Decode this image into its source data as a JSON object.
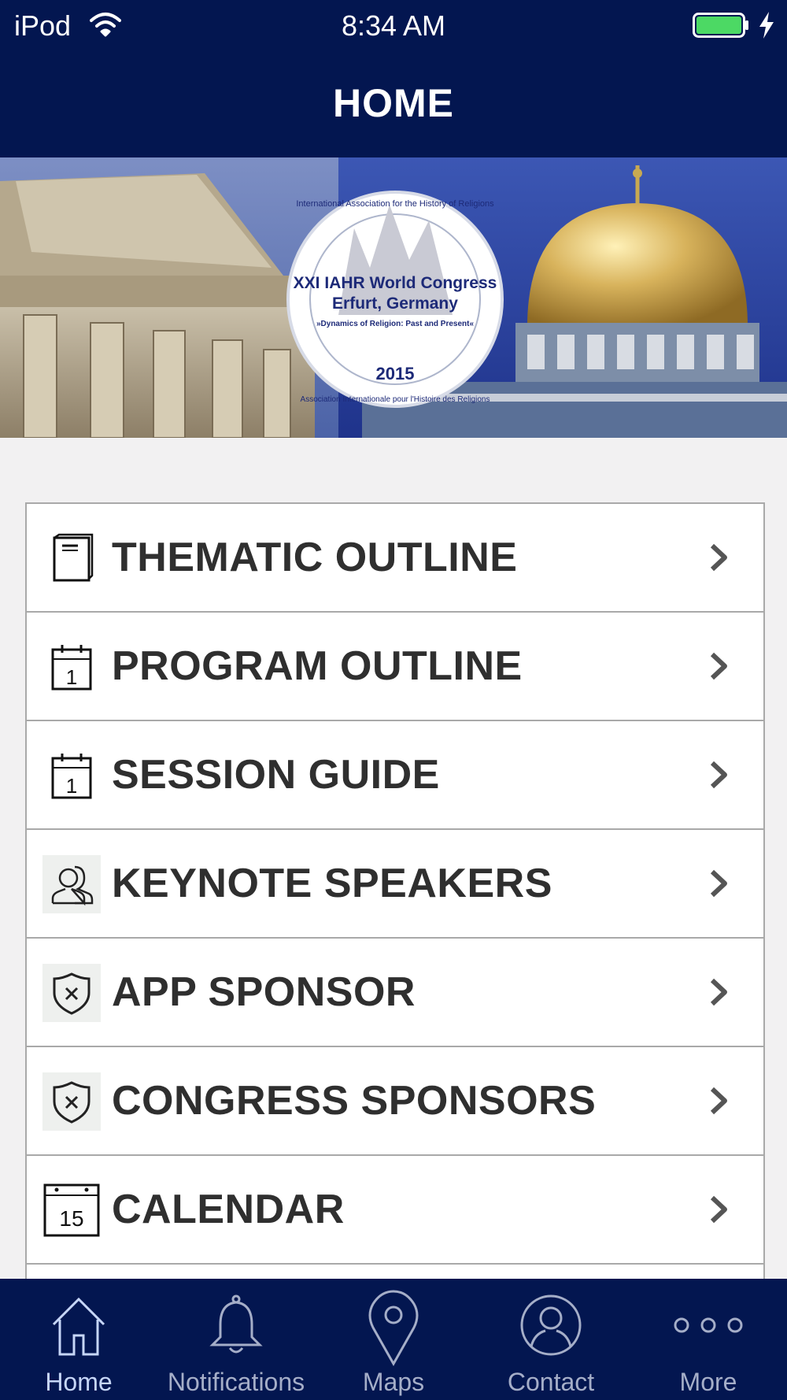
{
  "status_bar": {
    "carrier": "iPod",
    "time": "8:34 AM",
    "battery_color": "#4cd964"
  },
  "header": {
    "title": "HOME"
  },
  "banner": {
    "logo_arc_top": "International Association for the History of Religions",
    "logo_line1": "XXI IAHR World Congress",
    "logo_line2": "Erfurt, Germany",
    "logo_line3": "»Dynamics of Religion: Past and Present«",
    "logo_year": "2015",
    "logo_arc_bottom": "Association Internationale pour l'Histoire des Religions"
  },
  "menu": {
    "items": [
      {
        "label": "THEMATIC OUTLINE",
        "icon": "book-icon"
      },
      {
        "label": "PROGRAM OUTLINE",
        "icon": "calendar-day-icon",
        "icon_text": "1"
      },
      {
        "label": "SESSION GUIDE",
        "icon": "calendar-day-icon",
        "icon_text": "1"
      },
      {
        "label": "KEYNOTE SPEAKERS",
        "icon": "people-icon"
      },
      {
        "label": "APP SPONSOR",
        "icon": "shield-icon"
      },
      {
        "label": "CONGRESS SPONSORS",
        "icon": "shield-icon"
      },
      {
        "label": "CALENDAR",
        "icon": "calendar-icon",
        "icon_text": "15"
      }
    ]
  },
  "tab_bar": {
    "active": "Home",
    "tabs": [
      {
        "label": "Home",
        "icon": "home-icon"
      },
      {
        "label": "Notifications",
        "icon": "bell-icon"
      },
      {
        "label": "Maps",
        "icon": "map-pin-icon"
      },
      {
        "label": "Contact",
        "icon": "contact-icon"
      },
      {
        "label": "More",
        "icon": "more-icon"
      }
    ]
  },
  "colors": {
    "header_bg": "#031650",
    "page_bg": "#f2f1f2",
    "menu_text": "#2f2f2f",
    "tab_label": "#a5aec8"
  }
}
